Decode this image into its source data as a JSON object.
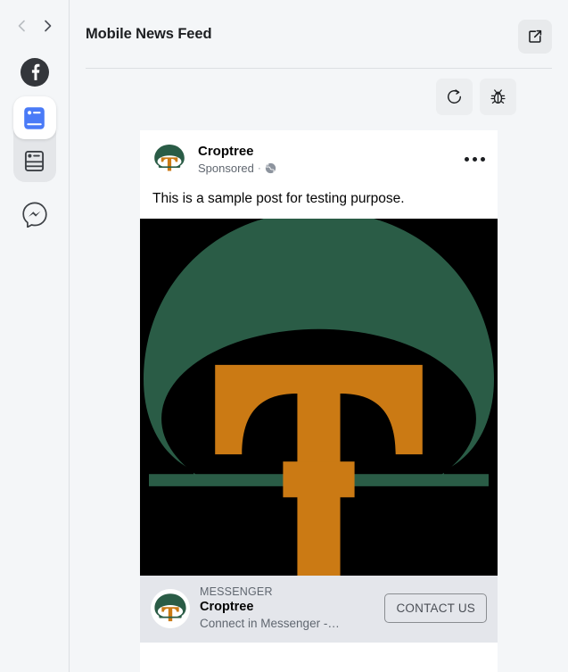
{
  "sidebar": {
    "back_arrow": "back-arrow",
    "forward_arrow": "forward-arrow",
    "items": [
      {
        "name": "facebook-logo",
        "label": "Facebook"
      },
      {
        "name": "mobile-feed",
        "label": "Mobile News Feed",
        "selected": true
      },
      {
        "name": "desktop-feed",
        "label": "Desktop News Feed",
        "selected": false
      },
      {
        "name": "messenger",
        "label": "Messenger",
        "selected": false
      }
    ]
  },
  "header": {
    "title": "Mobile News Feed",
    "open_external_label": "Open in new window"
  },
  "toolbar": {
    "refresh_label": "Refresh",
    "debug_label": "Debug"
  },
  "post": {
    "page_name": "Croptree",
    "sponsored_label": "Sponsored",
    "separator": "·",
    "audience_icon": "globe-icon",
    "menu_label": "More options",
    "body_text": "This is a sample post for testing purpose.",
    "media_alt": "Croptree logo: green tree canopy with orange letter T"
  },
  "cta": {
    "eyebrow": "MESSENGER",
    "title": "Croptree",
    "subtitle": "Connect in Messenger -…",
    "button_label": "CONTACT US"
  },
  "colors": {
    "brand_green": "#2a5c46",
    "brand_orange": "#cb7a14",
    "media_background": "#000000",
    "facebook_blue": "#4a7bf7",
    "page_background": "#f4f6f8",
    "card_background": "#ffffff",
    "cta_background": "#e4e6eb"
  }
}
